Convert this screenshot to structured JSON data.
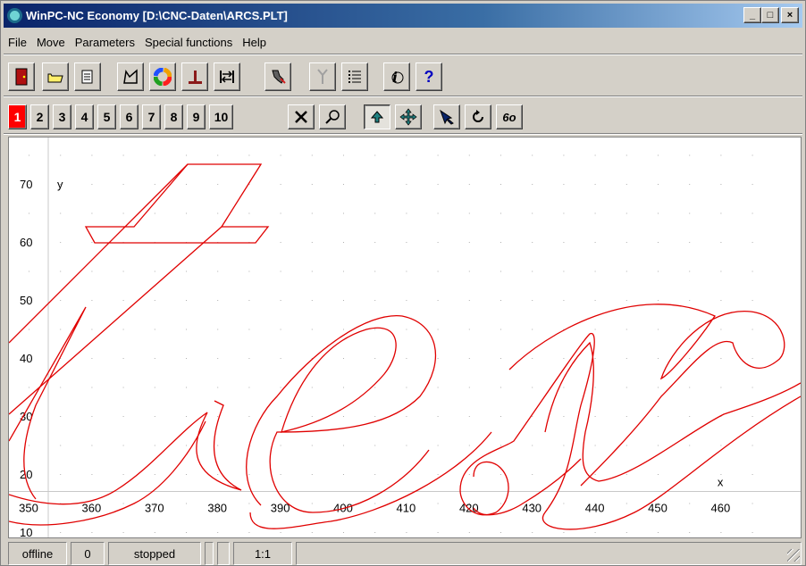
{
  "window": {
    "title": "WinPC-NC Economy [D:\\CNC-Daten\\ARCS.PLT]",
    "controls": {
      "minimize": "_",
      "maximize": "□",
      "close": "×"
    }
  },
  "menu": [
    "File",
    "Move",
    "Parameters",
    "Special functions",
    "Help"
  ],
  "toolbar1": [
    {
      "icon": "exit-door-icon",
      "glyph": "▮"
    },
    {
      "icon": "open-folder-icon",
      "glyph": "⌂"
    },
    {
      "icon": "document-icon",
      "glyph": "▤"
    },
    {
      "icon": "vector-edit-icon",
      "glyph": "⌗"
    },
    {
      "icon": "color-wheel-icon",
      "glyph": "◉"
    },
    {
      "icon": "reference-point-icon",
      "glyph": "⊥"
    },
    {
      "icon": "fit-to-window-icon",
      "glyph": "⇆"
    },
    {
      "icon": "tool-settings-icon",
      "glyph": "⚙"
    },
    {
      "icon": "tool-change-icon",
      "glyph": "ɣ"
    },
    {
      "icon": "list-icon",
      "glyph": "☰"
    },
    {
      "icon": "info-icon",
      "glyph": "ℹ"
    },
    {
      "icon": "help-icon",
      "glyph": "?"
    }
  ],
  "layers": [
    "1",
    "2",
    "3",
    "4",
    "5",
    "6",
    "7",
    "8",
    "9",
    "10"
  ],
  "active_layer": "1",
  "toolbar2": [
    {
      "icon": "close-view-icon",
      "glyph": "✕"
    },
    {
      "icon": "zoom-icon",
      "glyph": "⌕"
    },
    {
      "icon": "arrow-up-icon",
      "glyph": "⇧"
    },
    {
      "icon": "move-icon",
      "glyph": "✥"
    },
    {
      "icon": "pointer-icon",
      "glyph": "➘"
    },
    {
      "icon": "redraw-icon",
      "glyph": "↺"
    },
    {
      "icon": "glasses-icon",
      "glyph": "6o"
    }
  ],
  "plot": {
    "x_ticks": [
      "350",
      "360",
      "370",
      "380",
      "390",
      "400",
      "410",
      "420",
      "430",
      "440",
      "450",
      "460"
    ],
    "y_ticks": [
      "10",
      "20",
      "30",
      "40",
      "50",
      "60",
      "70"
    ],
    "x_label": "x",
    "y_label": "y",
    "path_color": "#e00000"
  },
  "status": {
    "connection": "offline",
    "value": "0",
    "state": "stopped",
    "scale": "1:1"
  }
}
